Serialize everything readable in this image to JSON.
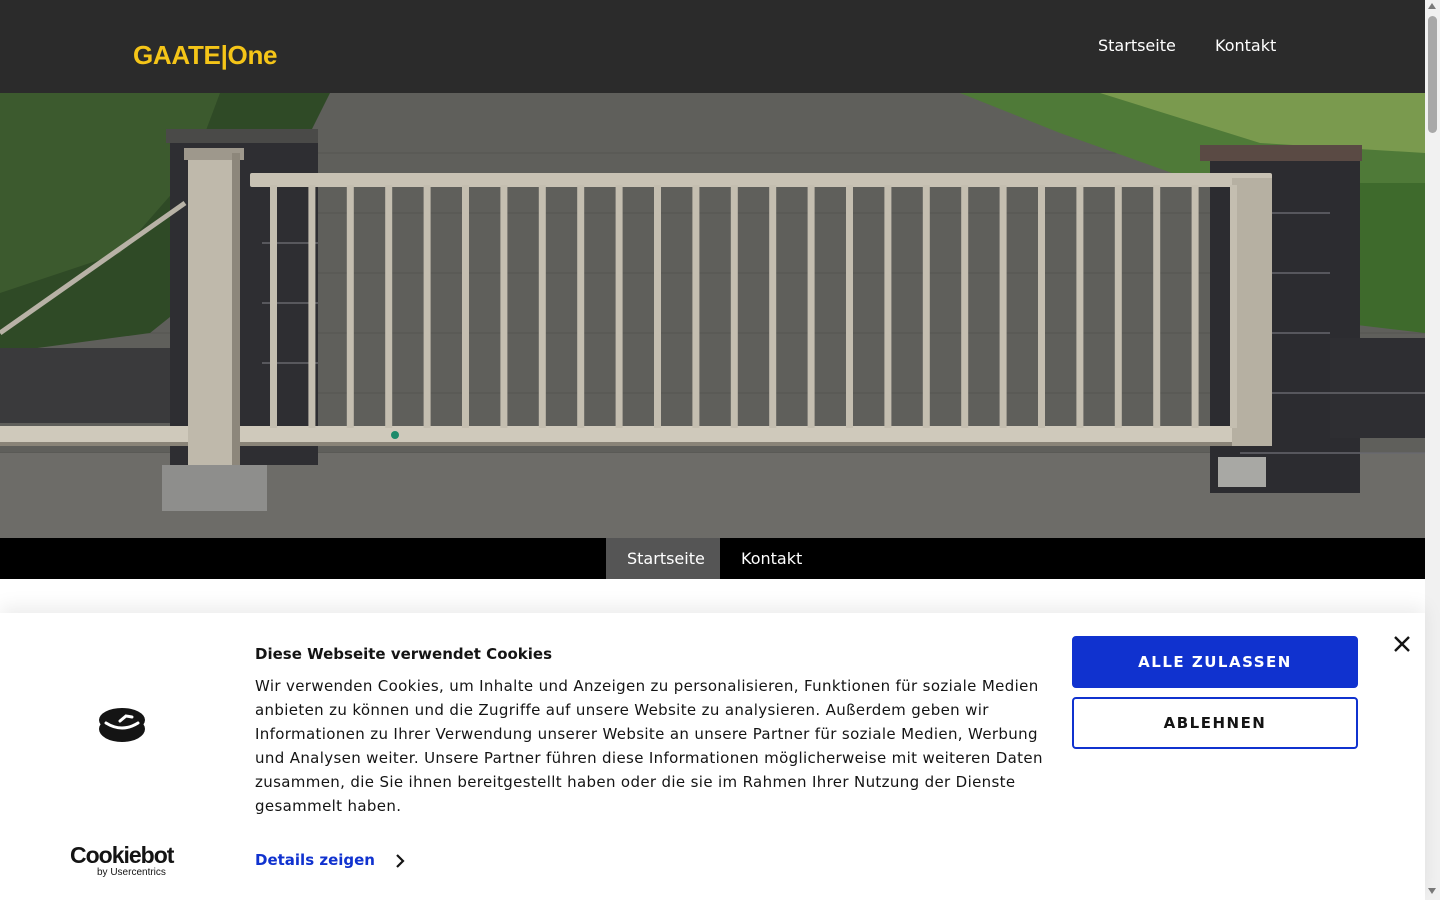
{
  "header": {
    "logo": "GAATE|One",
    "nav": [
      "Startseite",
      "Kontakt"
    ]
  },
  "subnav": {
    "items": [
      "Startseite",
      "Kontakt"
    ],
    "active": "Startseite"
  },
  "hero": {
    "image": "sliding-gate-photo"
  },
  "cookie_banner": {
    "title": "Diese Webseite verwendet Cookies",
    "text": "Wir verwenden Cookies, um Inhalte und Anzeigen zu personalisieren, Funktionen für soziale Medien anbieten zu können und die Zugriffe auf unsere Website zu analysieren. Außerdem geben wir Informationen zu Ihrer Verwendung unserer Website an unsere Partner für soziale Medien, Werbung und Analysen weiter. Unsere Partner führen diese Informationen möglicherweise mit weiteren Daten zusammen, die Sie ihnen bereitgestellt haben oder die sie im Rahmen Ihrer Nutzung der Dienste gesammelt haben.",
    "details_label": "Details zeigen",
    "allow_all_label": "ALLE ZULASSEN",
    "deny_label": "ABLEHNEN",
    "brand_main": "Cookiebot",
    "brand_sub": "by Usercentrics"
  },
  "colors": {
    "header_bg": "#2b2b2b",
    "logo": "#f5c518",
    "subnav_bg": "#000000",
    "subnav_active": "#555555",
    "cookie_accent": "#1032cf"
  }
}
